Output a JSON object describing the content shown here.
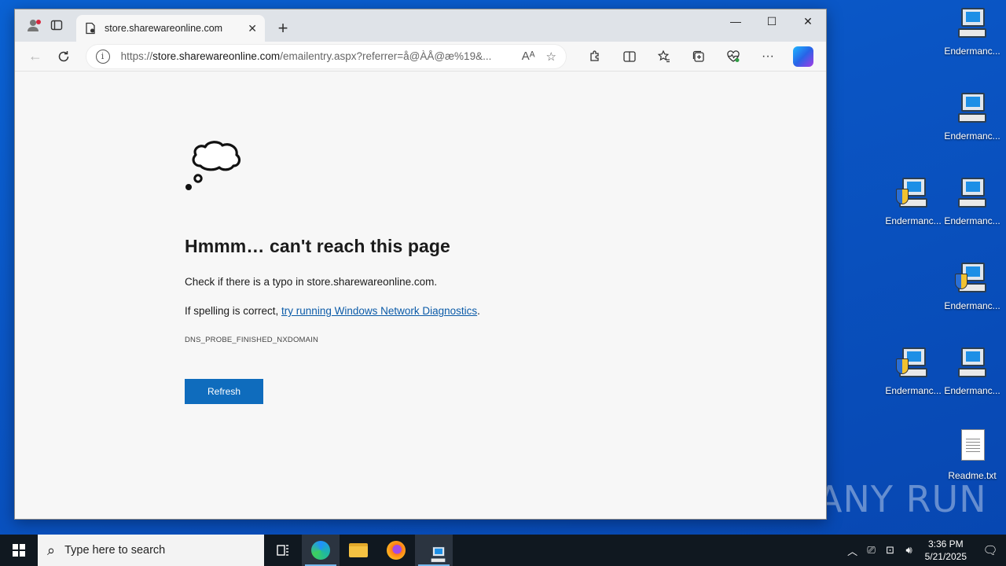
{
  "desktop": {
    "icons": [
      {
        "label": "Endermanc...",
        "kind": "pc"
      },
      {
        "label": "Endermanc...",
        "kind": "pc"
      },
      {
        "label": "Endermanc...",
        "kind": "pc-shield"
      },
      {
        "label": "Endermanc...",
        "kind": "pc"
      },
      {
        "label": "Endermanc...",
        "kind": "pc-shield"
      },
      {
        "label": "Endermanc...",
        "kind": "pc-shield"
      },
      {
        "label": "Endermanc...",
        "kind": "pc"
      },
      {
        "label": "Readme.txt",
        "kind": "text-file"
      }
    ],
    "watermark": "ANY RUN"
  },
  "browser": {
    "tab": {
      "title": "store.sharewareonline.com"
    },
    "address": {
      "scheme": "https://",
      "host": "store.sharewareonline.com",
      "path": "/emailentry.aspx?referrer=å@ÀÅ@æ%19&..."
    },
    "icons": {
      "profile": "profile-icon",
      "workspaces": "workspaces-icon",
      "info": "i"
    }
  },
  "error_page": {
    "heading": "Hmmm… can't reach this page",
    "line1": "Check if there is a typo in store.sharewareonline.com.",
    "line2_prefix": "If spelling is correct, ",
    "line2_link": "try running Windows Network Diagnostics",
    "line2_suffix": ".",
    "error_code": "DNS_PROBE_FINISHED_NXDOMAIN",
    "refresh_label": "Refresh"
  },
  "taskbar": {
    "search_placeholder": "Type here to search",
    "time": "3:36 PM",
    "date": "5/21/2025"
  }
}
